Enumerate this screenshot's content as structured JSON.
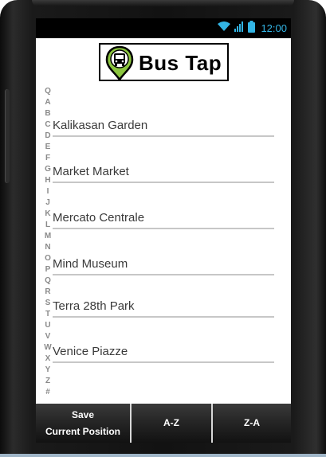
{
  "status_bar": {
    "time": "12:00",
    "icons": [
      "wifi-icon",
      "signal-icon",
      "battery-icon"
    ],
    "accent_color": "#33b5e5"
  },
  "app": {
    "title": "Bus Tap",
    "logo_icon": "bus-location-pin-icon",
    "logo_pin_color": "#8cc63f"
  },
  "alphabet_index": [
    "Q",
    "A",
    "B",
    "C",
    "D",
    "E",
    "F",
    "G",
    "H",
    "I",
    "J",
    "K",
    "L",
    "M",
    "N",
    "O",
    "P",
    "Q",
    "R",
    "S",
    "T",
    "U",
    "V",
    "W",
    "X",
    "Y",
    "Z",
    "#"
  ],
  "places": [
    {
      "label": "Kalikasan Garden"
    },
    {
      "label": "Market Market"
    },
    {
      "label": "Mercato Centrale"
    },
    {
      "label": "Mind Museum"
    },
    {
      "label": "Terra 28th Park"
    },
    {
      "label": "Venice Piazze"
    }
  ],
  "bottom_bar": {
    "save_line1": "Save",
    "save_line2": "Current Position",
    "sort_az": "A-Z",
    "sort_za": "Z-A"
  }
}
